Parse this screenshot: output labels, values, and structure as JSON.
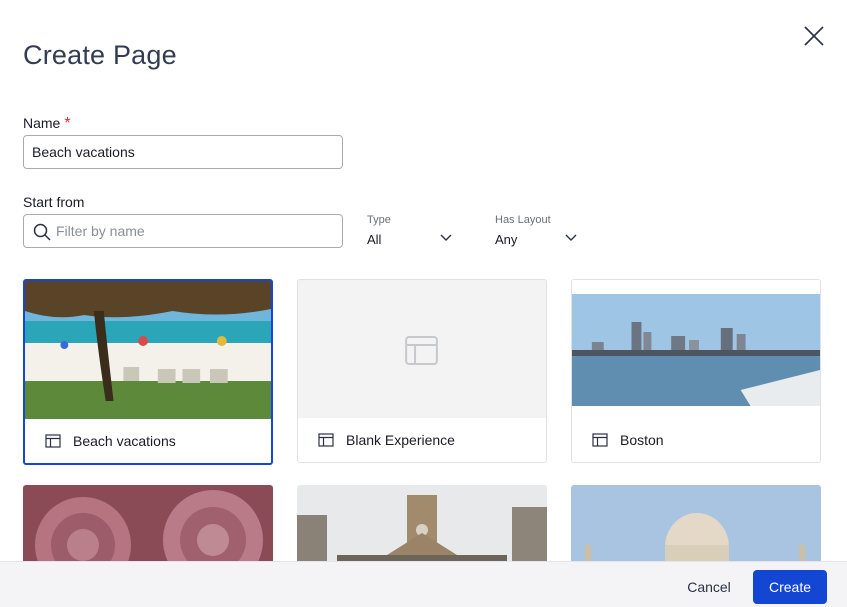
{
  "dialog": {
    "title": "Create Page",
    "close_icon": "close-icon"
  },
  "name_field": {
    "label": "Name",
    "required_mark": "*",
    "value": "Beach vacations"
  },
  "start_from": {
    "label": "Start from",
    "search_placeholder": "Filter by name",
    "search_icon": "search-icon"
  },
  "filters": {
    "type": {
      "label": "Type",
      "value": "All"
    },
    "has_layout": {
      "label": "Has Layout",
      "value": "Any"
    }
  },
  "templates": [
    {
      "name": "Beach vacations",
      "selected": true,
      "icon": "layout-icon"
    },
    {
      "name": "Blank Experience",
      "selected": false,
      "icon": "layout-icon"
    },
    {
      "name": "Boston",
      "selected": false,
      "icon": "layout-icon"
    },
    {
      "name": "",
      "selected": false
    },
    {
      "name": "",
      "selected": false
    },
    {
      "name": "",
      "selected": false
    }
  ],
  "footer": {
    "cancel_label": "Cancel",
    "create_label": "Create"
  },
  "colors": {
    "accent": "#1446d4",
    "required": "#d92f2f",
    "footer_bg": "#f4f4f6"
  }
}
